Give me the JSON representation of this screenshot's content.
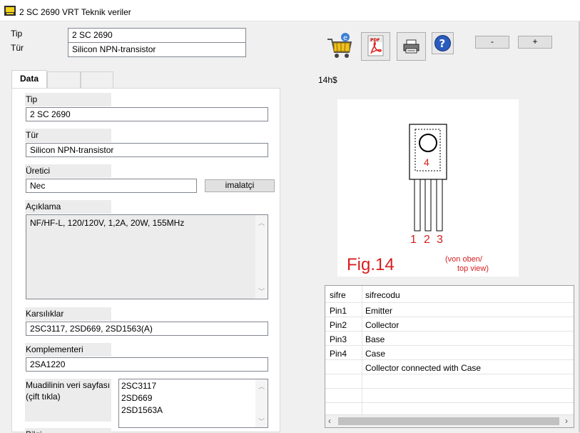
{
  "window": {
    "title": "2 SC 2690 VRT Teknik veriler"
  },
  "header": {
    "tip_label": "Tip",
    "tip_value": "2 SC 2690",
    "tur_label": "Tür",
    "tur_value": "Silicon NPN-transistor"
  },
  "toolbar": {
    "minus_label": "-",
    "plus_label": "+",
    "price": "14h$"
  },
  "tabs": [
    {
      "label": "Data"
    },
    {
      "label": ""
    },
    {
      "label": ""
    }
  ],
  "form": {
    "tip_label": "Tip",
    "tip_value": "2 SC 2690",
    "tur_label": "Tür",
    "tur_value": "Silicon NPN-transistor",
    "uretici_label": "Üretici",
    "uretici_value": "Nec",
    "imalatci_button": "imalatçi",
    "aciklama_label": "Açıklama",
    "aciklama_value": "NF/HF-L, 120/120V, 1,2A, 20W, 155MHz",
    "karsiliklar_label": "Karsılıklar",
    "karsiliklar_value": "2SC3117, 2SD669, 2SD1563(A)",
    "komplementeri_label": "Komplementeri",
    "komplementeri_value": "2SA1220",
    "muadil_label_line1": "Muadilinin veri sayfası",
    "muadil_label_line2": "(çift tıkla)",
    "muadil_items": [
      "2SC3117",
      "2SD669",
      "2SD1563A"
    ],
    "bilgi_label": "Bilgi"
  },
  "figure": {
    "case_number": "4",
    "pin_labels": [
      "1",
      "2",
      "3"
    ],
    "fig_label": "Fig.14",
    "view_label_line1": "(von oben/",
    "view_label_line2": "top view)"
  },
  "pin_table": {
    "headers": [
      "sifre",
      "sifrecodu"
    ],
    "rows": [
      [
        "Pin1",
        "Emitter"
      ],
      [
        "Pin2",
        "Collector"
      ],
      [
        "Pin3",
        "Base"
      ],
      [
        "Pin4",
        "Case"
      ],
      [
        "",
        "Collector connected with Case"
      ],
      [
        "",
        ""
      ],
      [
        "",
        ""
      ],
      [
        "",
        ""
      ]
    ]
  },
  "colors": {
    "figure_red": "#d81e1e",
    "help_blue": "#2a5bbd"
  },
  "icons": [
    "app-icon",
    "shopping-cart-icon",
    "pdf-icon",
    "printer-icon",
    "help-icon"
  ]
}
